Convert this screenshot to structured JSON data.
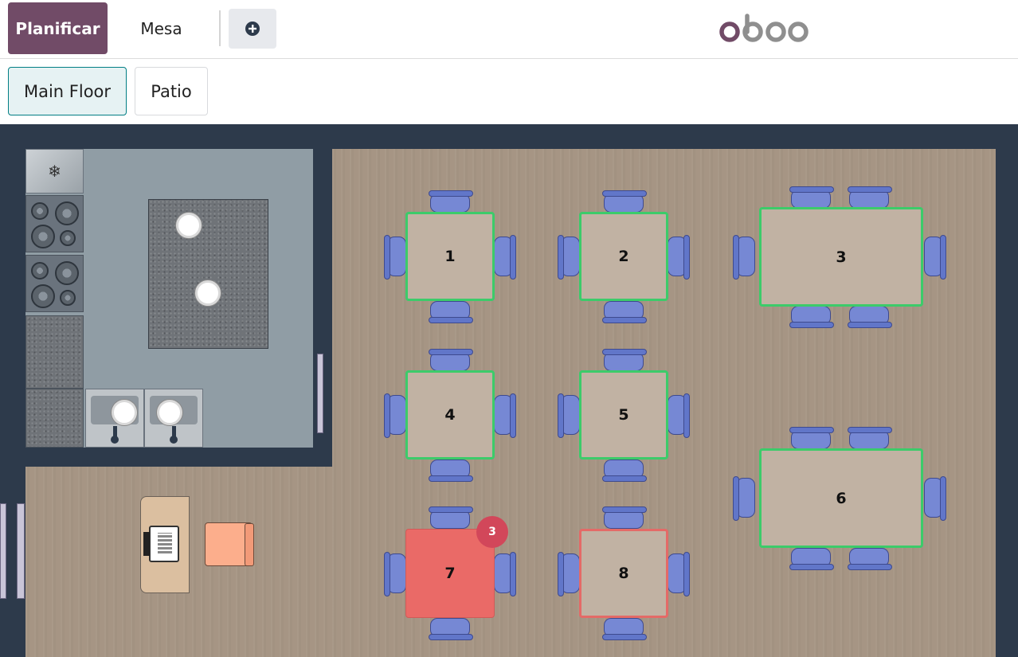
{
  "navbar": {
    "plan_label": "Planificar",
    "table_label": "Mesa",
    "add_icon": "plus-circle-icon",
    "logo_text": "odoo",
    "brand_color": "#714b67"
  },
  "floors": {
    "items": [
      {
        "label": "Main Floor",
        "active": true
      },
      {
        "label": "Patio",
        "active": false
      }
    ]
  },
  "tables": [
    {
      "number": "1",
      "status": "available",
      "border_color": "#3ccb6a"
    },
    {
      "number": "2",
      "status": "available",
      "border_color": "#3ccb6a"
    },
    {
      "number": "3",
      "status": "available",
      "border_color": "#3ccb6a"
    },
    {
      "number": "4",
      "status": "available",
      "border_color": "#3ccb6a"
    },
    {
      "number": "5",
      "status": "available",
      "border_color": "#3ccb6a"
    },
    {
      "number": "6",
      "status": "available",
      "border_color": "#3ccb6a"
    },
    {
      "number": "7",
      "status": "occupied",
      "fill_color": "#ea6a67",
      "order_count": "3"
    },
    {
      "number": "8",
      "status": "late",
      "border_color": "#e46a67"
    }
  ],
  "decor": {
    "fridge_icon": "snowflake-icon",
    "register_icon": "cash-register-icon"
  }
}
